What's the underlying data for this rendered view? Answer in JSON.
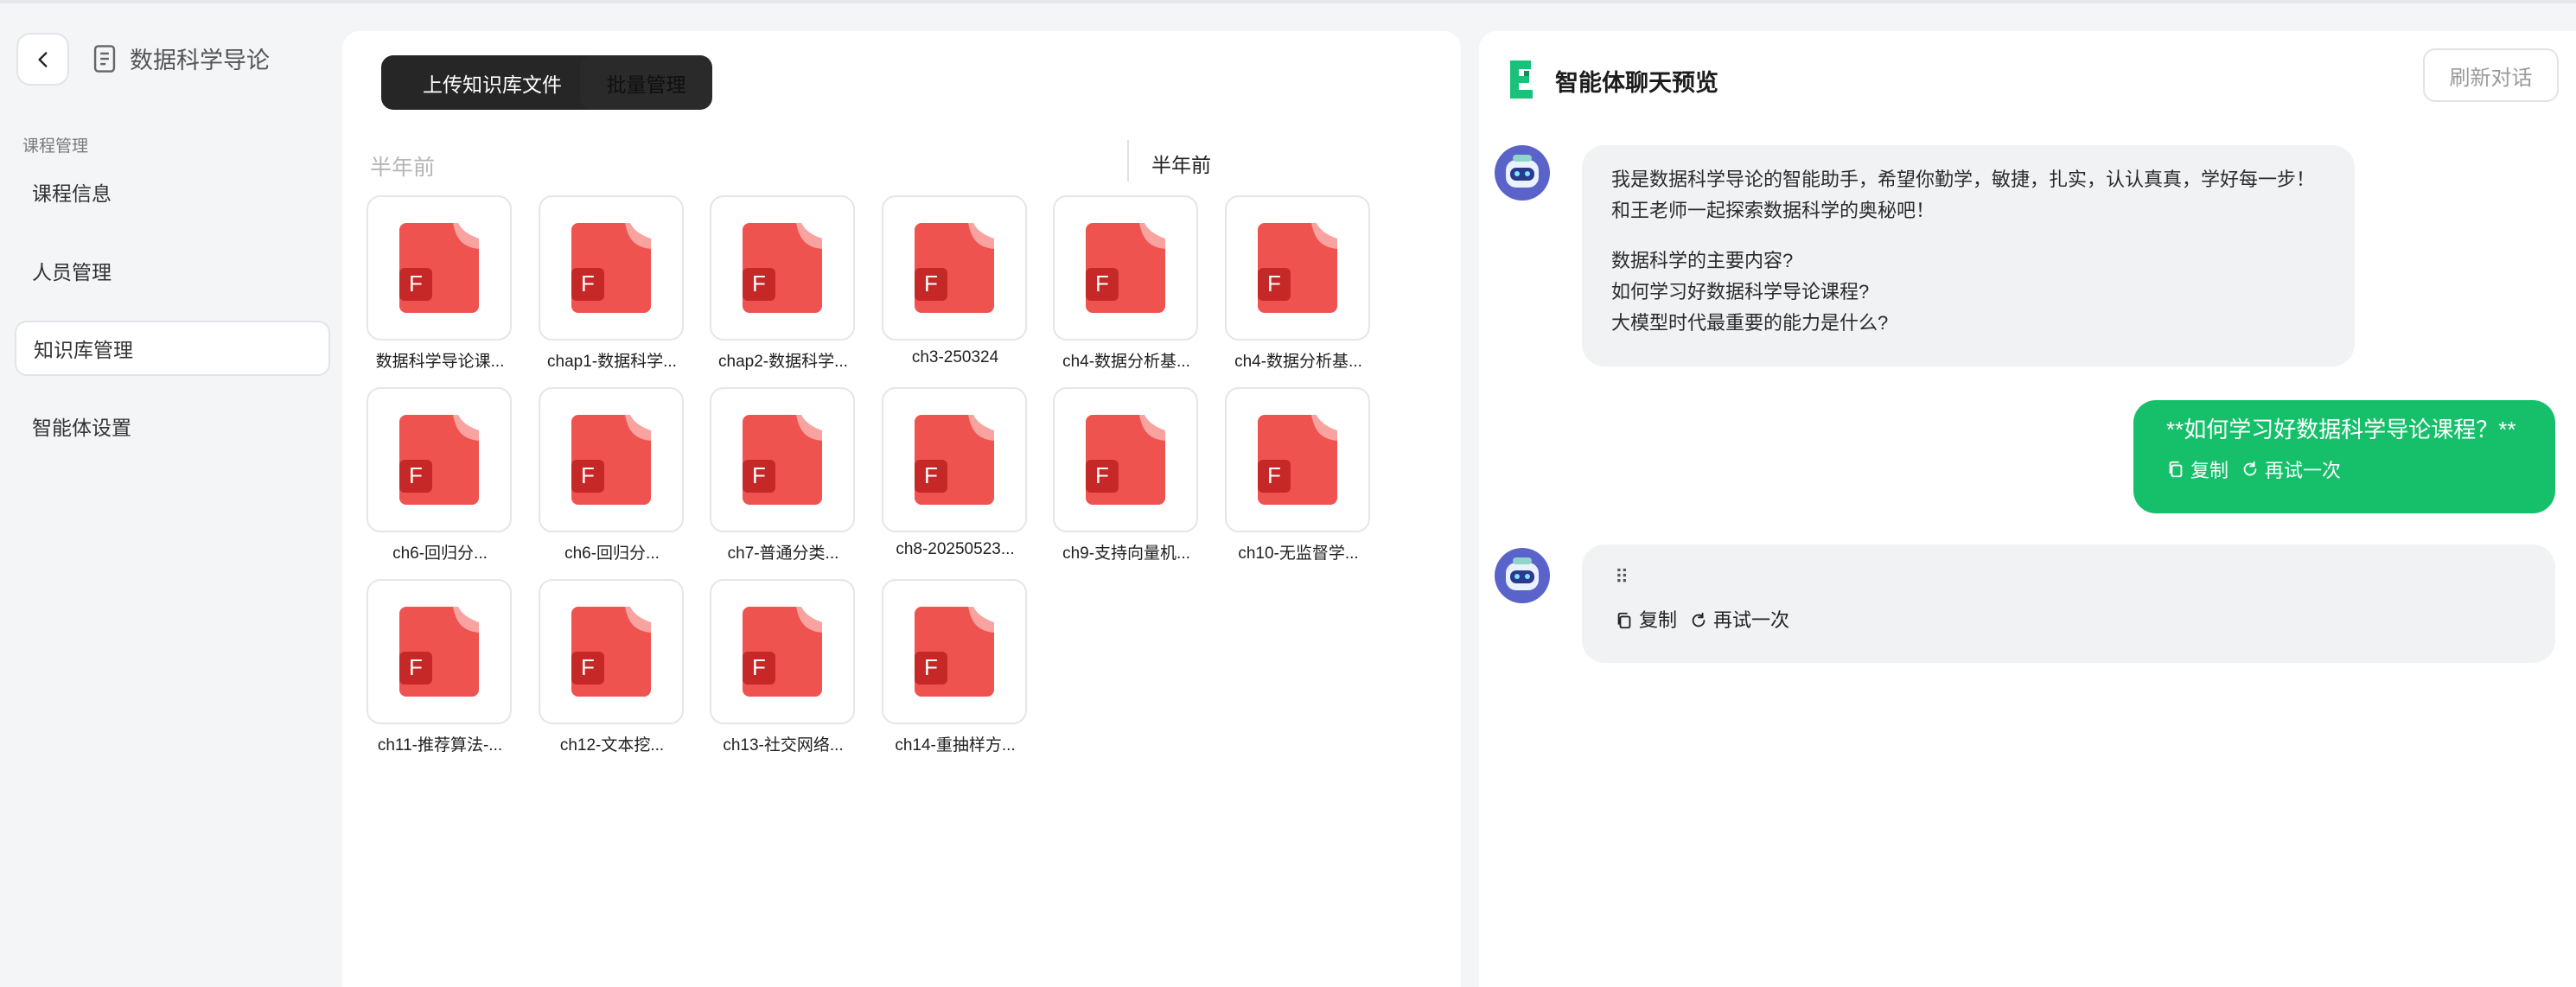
{
  "sidebar": {
    "course_title": "数据科学导论",
    "section_label": "课程管理",
    "items": [
      {
        "label": "课程信息"
      },
      {
        "label": "人员管理"
      },
      {
        "label": "知识库管理"
      },
      {
        "label": "智能体设置"
      }
    ],
    "active_index": 2
  },
  "knowledge": {
    "upload_label": "上传知识库文件",
    "batch_label": "批量管理",
    "group_label": "半年前",
    "group_label_right": "半年前",
    "files": [
      {
        "name": "数据科学导论课..."
      },
      {
        "name": "chap1-数据科学..."
      },
      {
        "name": "chap2-数据科学..."
      },
      {
        "name": "ch3-250324"
      },
      {
        "name": "ch4-数据分析基..."
      },
      {
        "name": "ch4-数据分析基..."
      },
      {
        "name": "ch6-回归分..."
      },
      {
        "name": "ch6-回归分..."
      },
      {
        "name": "ch7-普通分类..."
      },
      {
        "name": "ch8-20250523..."
      },
      {
        "name": "ch9-支持向量机..."
      },
      {
        "name": "ch10-无监督学..."
      },
      {
        "name": "ch11-推荐算法-..."
      },
      {
        "name": "ch12-文本挖..."
      },
      {
        "name": "ch13-社交网络..."
      },
      {
        "name": "ch14-重抽样方..."
      }
    ],
    "file_icon_letter": "F",
    "file_icon_color": "#ef5350"
  },
  "chat": {
    "title": "智能体聊天预览",
    "refresh_label": "刷新对话",
    "bot_intro_line1": "我是数据科学导论的智能助手，希望你勤学，敏捷，扎实，认认真真，学好每一步！",
    "bot_intro_line2": "和王老师一起探索数据科学的奥秘吧！",
    "suggestions": [
      "数据科学的主要内容?",
      "如何学习好数据科学导论课程?",
      "大模型时代最重要的能力是什么?"
    ],
    "user_message": "**如何学习好数据科学导论课程？**",
    "copy_label": "复制",
    "retry_label": "再试一次",
    "loading_glyph": "⠿",
    "user_bubble_color": "#16c06b",
    "bot_bubble_color": "#f1f2f4"
  }
}
